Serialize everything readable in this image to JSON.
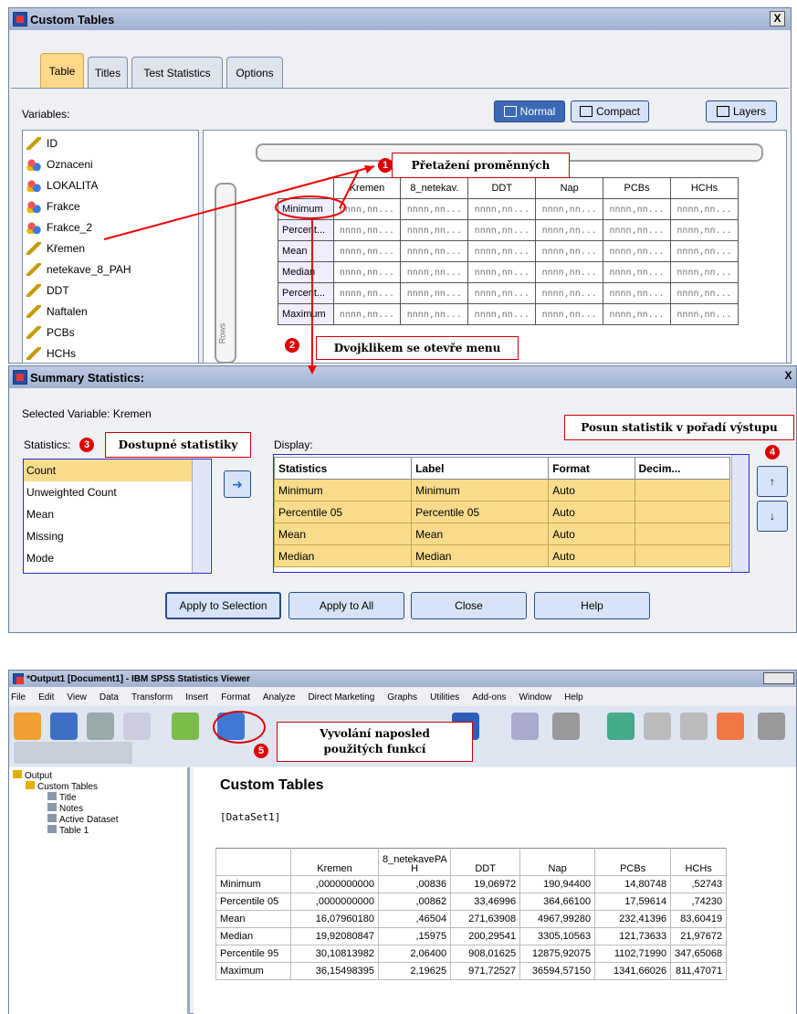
{
  "custom_tables": {
    "title": "Custom Tables",
    "close": "X",
    "tabs": [
      "Table",
      "Titles",
      "Test Statistics",
      "Options"
    ],
    "variables_label": "Variables:",
    "view_buttons": {
      "normal": "Normal",
      "compact": "Compact",
      "layers": "Layers"
    },
    "variables": [
      {
        "name": "ID",
        "icon": "scale-icon"
      },
      {
        "name": "Oznaceni",
        "icon": "nominal-icon"
      },
      {
        "name": "LOKALITA",
        "icon": "nominal-icon"
      },
      {
        "name": "Frakce",
        "icon": "nominal-icon"
      },
      {
        "name": "Frakce_2",
        "icon": "nominal-icon"
      },
      {
        "name": "Křemen",
        "icon": "scale-icon"
      },
      {
        "name": "netekave_8_PAH",
        "icon": "scale-icon"
      },
      {
        "name": "DDT",
        "icon": "scale-icon"
      },
      {
        "name": "Naftalen",
        "icon": "scale-icon"
      },
      {
        "name": "PCBs",
        "icon": "scale-icon"
      },
      {
        "name": "HCHs",
        "icon": "scale-icon"
      }
    ],
    "rows_label": "Rows",
    "columns": [
      "Kremen",
      "8_netekav.",
      "DDT",
      "Nap",
      "PCBs",
      "HCHs"
    ],
    "row_stats": [
      "Minimum",
      "Percent...",
      "Mean",
      "Median",
      "Percent...",
      "Maximum"
    ],
    "placeholder": "nnnn,nn..."
  },
  "callouts": {
    "c1": "Přetažení proměnných",
    "c2": "Dvojklikem se otevře menu",
    "c3": "Dostupné statistiky",
    "c4": "Posun statistik v pořadí výstupu",
    "c5": "Vyvolání naposled použitých funkcí",
    "n1": "1",
    "n2": "2",
    "n3": "3",
    "n4": "4",
    "n5": "5"
  },
  "summary": {
    "title": "Summary Statistics:",
    "close": "X",
    "selected": "Selected Variable: Kremen",
    "stats_label": "Statistics:",
    "stats": [
      "Count",
      "Unweighted Count",
      "Mean",
      "Missing",
      "Mode"
    ],
    "display_label": "Display:",
    "headers": [
      "Statistics",
      "Label",
      "Format",
      "Decim..."
    ],
    "rows": [
      [
        "Minimum",
        "Minimum",
        "Auto"
      ],
      [
        "Percentile 05",
        "Percentile 05",
        "Auto"
      ],
      [
        "Mean",
        "Mean",
        "Auto"
      ],
      [
        "Median",
        "Median",
        "Auto"
      ]
    ],
    "buttons": [
      "Apply to Selection",
      "Apply to All",
      "Close",
      "Help"
    ]
  },
  "viewer": {
    "title": "*Output1 [Document1] - IBM SPSS Statistics Viewer",
    "menu": [
      "File",
      "Edit",
      "View",
      "Data",
      "Transform",
      "Insert",
      "Format",
      "Analyze",
      "Direct Marketing",
      "Graphs",
      "Utilities",
      "Add-ons",
      "Window",
      "Help"
    ],
    "tree": [
      "Output",
      "Custom Tables",
      "Title",
      "Notes",
      "Active Dataset",
      "Table 1"
    ],
    "heading": "Custom Tables",
    "dataset": "[DataSet1]",
    "cols": [
      "",
      "Kremen",
      "8_netekavePA H",
      "DDT",
      "Nap",
      "PCBs",
      "HCHs"
    ],
    "rows": [
      [
        "Minimum",
        ",0000000000",
        ",00836",
        "19,06972",
        "190,94400",
        "14,80748",
        ",52743"
      ],
      [
        "Percentile 05",
        ",0000000000",
        ",00862",
        "33,46996",
        "364,66100",
        "17,59614",
        ",74230"
      ],
      [
        "Mean",
        "16,07960180",
        ",46504",
        "271,63908",
        "4967,99280",
        "232,41396",
        "83,60419"
      ],
      [
        "Median",
        "19,92080847",
        ",15975",
        "200,29541",
        "3305,10563",
        "121,73633",
        "21,97672"
      ],
      [
        "Percentile 95",
        "30,10813982",
        "2,06400",
        "908,01625",
        "12875,92075",
        "1102,71990",
        "347,65068"
      ],
      [
        "Maximum",
        "36,15498395",
        "2,19625",
        "971,72527",
        "36594,57150",
        "1341,66026",
        "811,47071"
      ]
    ]
  }
}
